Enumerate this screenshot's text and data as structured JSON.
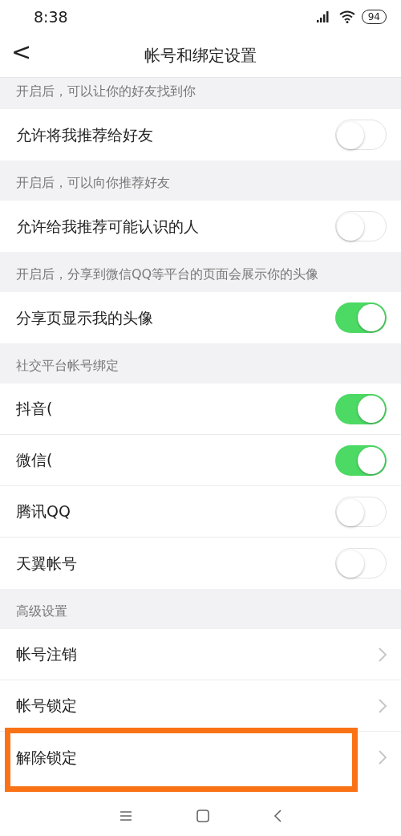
{
  "status_bar": {
    "time": "8:38",
    "battery": "94"
  },
  "header": {
    "back": "<",
    "title": "帐号和绑定设置"
  },
  "sections": [
    {
      "hint": "开启后，可以让你的好友找到你",
      "rows": [
        {
          "kind": "toggle",
          "label": "允许将我推荐给好友",
          "on": false
        }
      ]
    },
    {
      "hint": "开启后，可以向你推荐好友",
      "rows": [
        {
          "kind": "toggle",
          "label": "允许给我推荐可能认识的人",
          "on": false
        }
      ]
    },
    {
      "hint": "开启后，分享到微信QQ等平台的页面会展示你的头像",
      "rows": [
        {
          "kind": "toggle",
          "label": "分享页显示我的头像",
          "on": true
        }
      ]
    },
    {
      "hint": "社交平台帐号绑定",
      "rows": [
        {
          "kind": "toggle",
          "label": "抖音(",
          "on": true
        },
        {
          "kind": "toggle",
          "label": "微信(",
          "on": true
        },
        {
          "kind": "toggle",
          "label": "腾讯QQ",
          "on": false
        },
        {
          "kind": "toggle",
          "label": "天翼帐号",
          "on": false
        }
      ]
    },
    {
      "hint": "高级设置",
      "rows": [
        {
          "kind": "link",
          "label": "帐号注销",
          "highlighted": false
        },
        {
          "kind": "link",
          "label": "帐号锁定",
          "highlighted": false
        },
        {
          "kind": "link",
          "label": "解除锁定",
          "highlighted": true
        }
      ]
    }
  ]
}
